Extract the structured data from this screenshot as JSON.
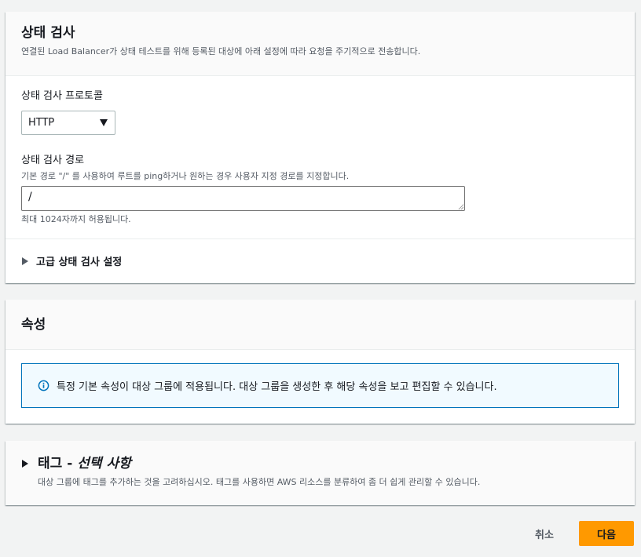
{
  "health_check": {
    "title": "상태 검사",
    "description": "연결된 Load Balancer가 상태 테스트를 위해 등록된 대상에 아래 설정에 따라 요청을 주기적으로 전송합니다.",
    "protocol": {
      "label": "상태 검사 프로토콜",
      "selected": "HTTP"
    },
    "path": {
      "label": "상태 검사 경로",
      "hint": "기본 경로 \"/\" 를 사용하여 루트를 ping하거나 원하는 경우 사용자 지정 경로를 지정합니다.",
      "value": "/",
      "constraint": "최대 1024자까지 허용됩니다."
    },
    "advanced_label": "고급 상태 검사 설정"
  },
  "attributes": {
    "title": "속성",
    "info_text": "특정 기본 속성이 대상 그룹에 적용됩니다. 대상 그룹을 생성한 후 해당 속성을 보고 편집할 수 있습니다."
  },
  "tags": {
    "title": "태그 -",
    "optional": "선택 사항",
    "description": "대상 그룹에 태그를 추가하는 것을 고려하십시오. 태그를 사용하면 AWS 리소스를 분류하여 좀 더 쉽게 관리할 수 있습니다."
  },
  "footer": {
    "cancel_label": "취소",
    "next_label": "다음"
  },
  "colors": {
    "primary_button": "#ff9900",
    "info_border": "#0073bb",
    "info_background": "#f1faff"
  },
  "icons": {
    "select_caret": "caret-down-icon",
    "expand": "caret-right-icon",
    "info": "info-icon"
  }
}
